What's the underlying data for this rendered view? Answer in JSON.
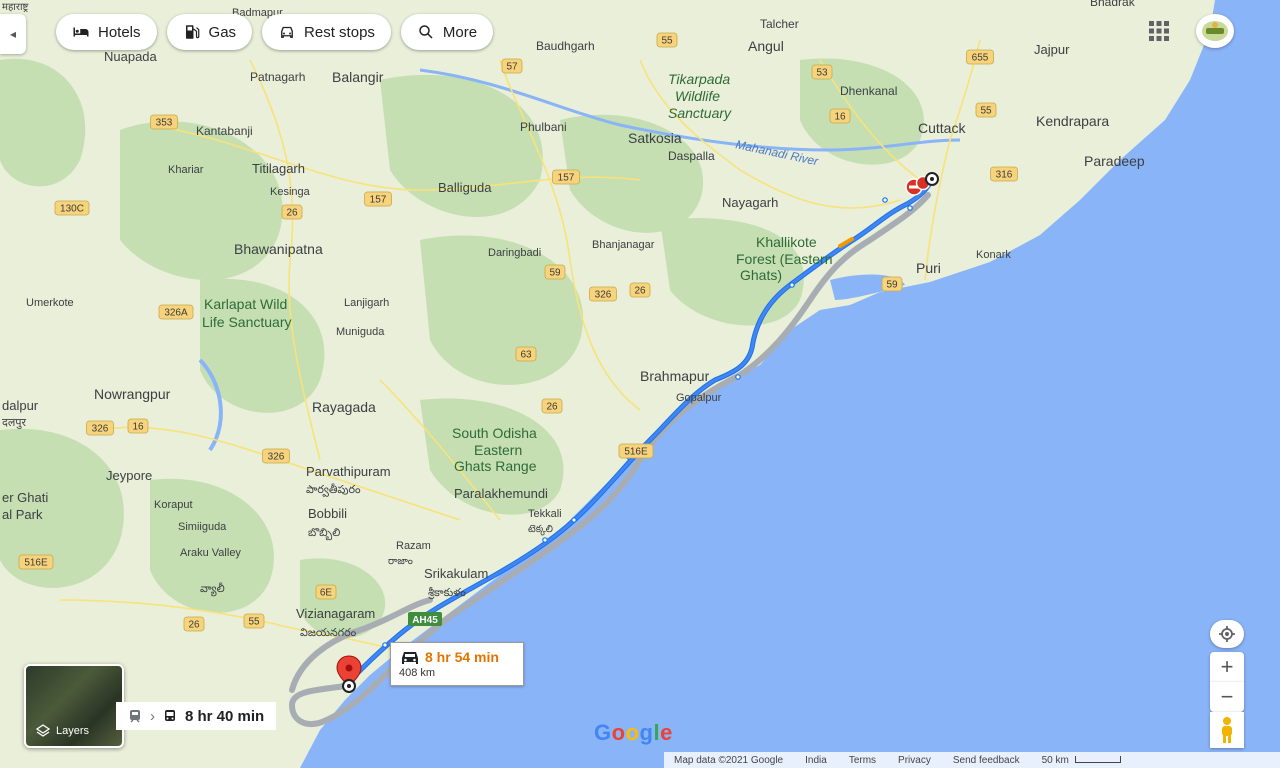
{
  "toolbar": {
    "hotels": "Hotels",
    "gas": "Gas",
    "rest_stops": "Rest stops",
    "more": "More"
  },
  "route": {
    "drive_time": "8 hr 54 min",
    "distance": "408 km",
    "transit_time": "8 hr 40 min",
    "highway_badge": "AH45"
  },
  "map_labels": {
    "mahanadi_river": "Mahanadi River",
    "tikarpada": "Tikarpada",
    "wildlife": "Wildlife",
    "sanctuary": "Sanctuary",
    "satkosia": "Satkosia",
    "cuttack": "Cuttack",
    "kendrapara": "Kendrapara",
    "paradeep": "Paradeep",
    "jajpur": "Jajpur",
    "bhadrak": "Bhadrak",
    "angul": "Angul",
    "talcher": "Talcher",
    "dhenkanal": "Dhenkanal",
    "nuapada": "Nuapada",
    "patnagarh": "Patnagarh",
    "balangir": "Balangir",
    "baudhgarh": "Baudhgarh",
    "kantabanji": "Kantabanji",
    "phulbani": "Phulbani",
    "daspalla": "Daspalla",
    "khariar": "Khariar",
    "titilagarh": "Titilagarh",
    "kesinga": "Kesinga",
    "balliguda": "Balliguda",
    "nayagarh": "Nayagarh",
    "khallikote": "Khallikote",
    "forest_eastern": "Forest (Eastern",
    "ghats": "Ghats)",
    "puri": "Puri",
    "konark": "Konark",
    "bhawanipatna": "Bhawanipatna",
    "daringbadi": "Daringbadi",
    "bhanjanagar": "Bhanjanagar",
    "umerkote": "Umerkote",
    "karlapat": "Karlapat Wild",
    "life_sanctuary": "Life Sanctuary",
    "lanjigarh": "Lanjigarh",
    "muniguda": "Muniguda",
    "brahmapur": "Brahmapur",
    "gopalpur": "Gopalpur",
    "nowrangpur": "Nowrangpur",
    "dalpur": "dalpur",
    "rayagada": "Rayagada",
    "south_odisha": "South Odisha",
    "eastern": "Eastern",
    "ghats_range": "Ghats Range",
    "jeypore": "Jeypore",
    "parvathipuram": "Parvathipuram",
    "paralakhemundi": "Paralakhemundi",
    "koraput": "Koraput",
    "bobbili": "Bobbili",
    "tekkali": "Tekkali",
    "simiiguda": "Simiiguda",
    "razam": "Razam",
    "araku": "Araku Valley",
    "srikakulam": "Srikakulam",
    "vizianagaram": "Vizianagaram",
    "ghati": "er Ghati",
    "park": "al Park",
    "badmapur": "Badmapur",
    "maharashtra": "महाराष्ट्र",
    "dalpur_hi": "दलपुर",
    "parvathipuram_te": "పార్వతీపురం",
    "bobbili_te": "బొబ్బిలి",
    "razam_te": "రాజాం",
    "tekkali_te": "టెక్కలి",
    "srikakulam_te": "శ్రీకాకుళం",
    "vizianagaram_te": "విజయనగరం",
    "araku_te": "వ్యాలీ"
  },
  "highway_shields": [
    "353",
    "130C",
    "26",
    "59",
    "157",
    "57",
    "55",
    "53",
    "655",
    "16",
    "55",
    "316",
    "59",
    "157",
    "59",
    "26",
    "326",
    "326A",
    "63",
    "26",
    "326",
    "16",
    "326",
    "516E",
    "516E",
    "26",
    "55",
    "6E"
  ],
  "footer": {
    "map_data": "Map data ©2021 Google",
    "country": "India",
    "terms": "Terms",
    "privacy": "Privacy",
    "feedback": "Send feedback",
    "scale": "50 km"
  },
  "controls": {
    "layers_label": "Layers",
    "zoom_in": "+",
    "zoom_out": "−",
    "collapse": "◂"
  },
  "brand": "Google",
  "colors": {
    "water": "#8ab4f8",
    "land": "#e9efd9",
    "forest": "#c5dfb3",
    "route_primary": "#4285f4",
    "route_alt": "#a8adb3",
    "highway_shield": "#f7d37b",
    "drive_time": "#e37400",
    "pin": "#ea4335"
  }
}
